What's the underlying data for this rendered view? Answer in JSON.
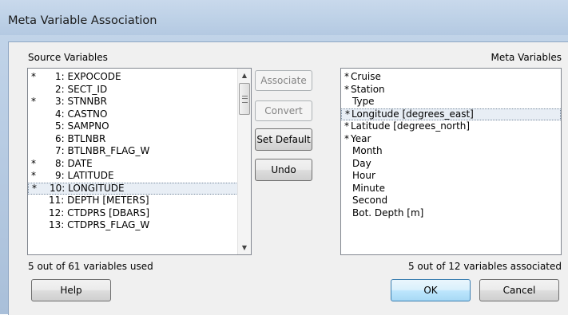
{
  "window": {
    "title": "Meta Variable Association"
  },
  "source": {
    "label": "Source Variables",
    "items": [
      {
        "star": "*",
        "text": "1: EXPOCODE"
      },
      {
        "star": "",
        "text": "2: SECT_ID"
      },
      {
        "star": "*",
        "text": "3: STNNBR"
      },
      {
        "star": "",
        "text": "4: CASTNO"
      },
      {
        "star": "",
        "text": "5: SAMPNO"
      },
      {
        "star": "",
        "text": "6: BTLNBR"
      },
      {
        "star": "",
        "text": "7: BTLNBR_FLAG_W"
      },
      {
        "star": "*",
        "text": "8: DATE"
      },
      {
        "star": "*",
        "text": "9: LATITUDE"
      },
      {
        "star": "*",
        "text": "10: LONGITUDE"
      },
      {
        "star": "",
        "text": "11: DEPTH [METERS]"
      },
      {
        "star": "",
        "text": "12: CTDPRS [DBARS]"
      },
      {
        "star": "",
        "text": "13: CTDPRS_FLAG_W"
      }
    ],
    "selected_index": 9,
    "status": "5 out of 61 variables used"
  },
  "meta": {
    "label": "Meta Variables",
    "items": [
      {
        "star": "*",
        "text": "Cruise"
      },
      {
        "star": "*",
        "text": "Station"
      },
      {
        "star": "",
        "text": "Type"
      },
      {
        "star": "*",
        "text": "Longitude [degrees_east]"
      },
      {
        "star": "*",
        "text": "Latitude [degrees_north]"
      },
      {
        "star": "*",
        "text": "Year"
      },
      {
        "star": "",
        "text": "Month"
      },
      {
        "star": "",
        "text": "Day"
      },
      {
        "star": "",
        "text": "Hour"
      },
      {
        "star": "",
        "text": "Minute"
      },
      {
        "star": "",
        "text": "Second"
      },
      {
        "star": "",
        "text": "Bot. Depth [m]"
      }
    ],
    "selected_index": 3,
    "status": "5 out of 12 variables associated"
  },
  "buttons": {
    "associate": "Associate",
    "convert": "Convert",
    "set_default": "Set Default",
    "undo": "Undo",
    "help": "Help",
    "ok": "OK",
    "cancel": "Cancel"
  },
  "colors": {
    "selection_bg": "#e8eef5",
    "title_bar": "#bcd0e6",
    "default_button": "#bee6fd"
  }
}
